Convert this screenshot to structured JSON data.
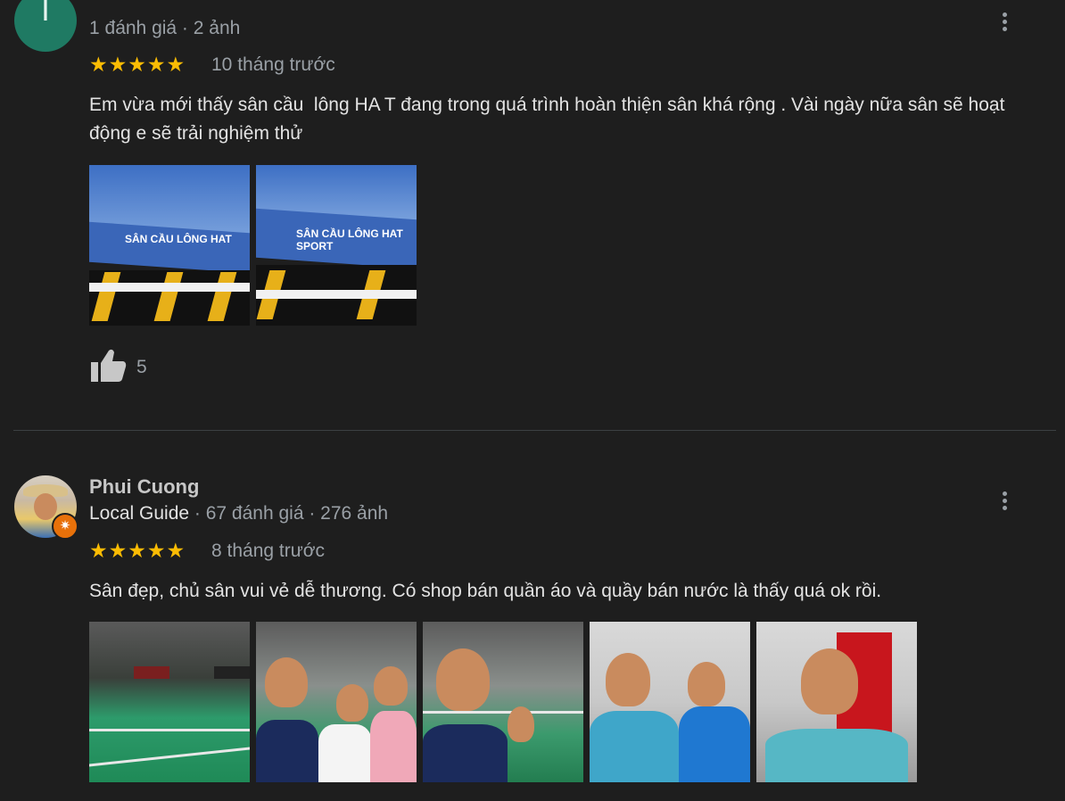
{
  "reviews": [
    {
      "avatar_letter": "I",
      "avatar_color": "#1f7a63",
      "meta": "1 đánh giá · 2 ảnh",
      "stars": "★★★★★",
      "rating": 5,
      "time": "10 tháng trước",
      "text": "Em vừa mới thấy sân cầu  lông HA T đang trong quá trình hoàn thiện sân khá rộng . Vài ngày nữa sân sẽ hoạt động e sẽ trải nghiệm thử",
      "photos": [
        {
          "banner_text": "SÂN CẦU LÔNG HAT"
        },
        {
          "banner_text": "SÂN CẦU LÔNG HAT SPORT"
        }
      ],
      "likes": "5"
    },
    {
      "author": "Phui Cuong",
      "badge": "Local Guide",
      "meta_rest": " · 67 đánh giá · 276 ảnh",
      "stars": "★★★★★",
      "rating": 5,
      "time": "8 tháng trước",
      "text": "Sân đẹp, chủ sân vui vẻ dễ thương. Có shop bán quần áo và quầy bán nước là thấy quá ok rồi."
    }
  ],
  "colors": {
    "background": "#1e1e1e",
    "star": "#fbbc04",
    "muted_text": "#9aa0a6",
    "local_guide_badge": "#e8710a"
  },
  "icons": [
    "more-vert-icon",
    "thumbs-up-icon",
    "local-guide-star-icon"
  ]
}
